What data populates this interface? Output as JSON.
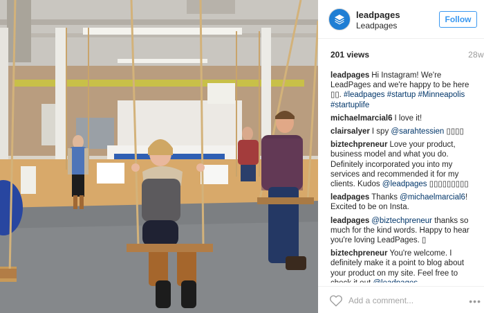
{
  "post": {
    "media": {
      "icon": "video-still-photo"
    },
    "header": {
      "username": "leadpages",
      "fullname": "Leadpages",
      "follow_label": "Follow",
      "avatar_color": "#1f7ed4"
    },
    "views": "201 views",
    "age": "28w",
    "comments": [
      {
        "user": "leadpages",
        "parts": [
          {
            "t": "Hi Instagram! We're LeadPages and we're happy to be here ▯▯. "
          },
          {
            "t": "#leadpages",
            "k": "tag"
          },
          {
            "t": " "
          },
          {
            "t": "#startup",
            "k": "tag"
          },
          {
            "t": " "
          },
          {
            "t": "#Minneapolis",
            "k": "tag"
          },
          {
            "t": " "
          },
          {
            "t": "#startuplife",
            "k": "tag"
          }
        ]
      },
      {
        "user": "michaelmarcial6",
        "parts": [
          {
            "t": "I love it!"
          }
        ]
      },
      {
        "user": "clairsalyer",
        "parts": [
          {
            "t": "I spy "
          },
          {
            "t": "@sarahtessien",
            "k": "mention"
          },
          {
            "t": " ▯▯▯▯"
          }
        ]
      },
      {
        "user": "biztechpreneur",
        "parts": [
          {
            "t": "Love your product, business model and what you do. Definitely incorporated you into my services and recommended it for my clients. Kudos "
          },
          {
            "t": "@leadpages",
            "k": "mention"
          },
          {
            "t": " ▯▯▯▯▯▯▯▯▯"
          }
        ]
      },
      {
        "user": "leadpages",
        "parts": [
          {
            "t": "Thanks "
          },
          {
            "t": "@michaelmarcial6",
            "k": "mention"
          },
          {
            "t": "! Excited to be on Insta."
          }
        ]
      },
      {
        "user": "leadpages",
        "parts": [
          {
            "t": "@biztechpreneur",
            "k": "mention"
          },
          {
            "t": " thanks so much for the kind words. Happy to hear you're loving LeadPages. ▯"
          }
        ]
      },
      {
        "user": "biztechpreneur",
        "parts": [
          {
            "t": "You're welcome. I definitely make it a point to blog about your product on my site. Feel free to check it out "
          },
          {
            "t": "@leadpages",
            "k": "mention"
          }
        ]
      }
    ],
    "footer": {
      "add_comment_placeholder": "Add a comment...",
      "more_label": "•••"
    }
  }
}
